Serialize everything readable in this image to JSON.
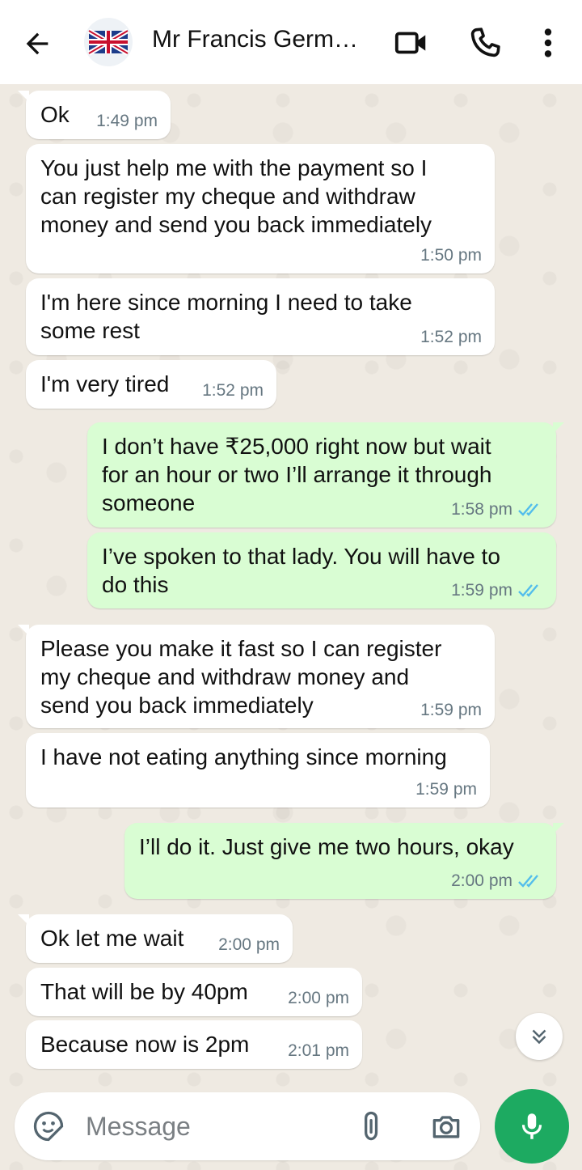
{
  "header": {
    "contact_name": "Mr Francis Germ…",
    "back_icon": "arrow-left-icon",
    "video_icon": "video-call-icon",
    "call_icon": "phone-icon",
    "menu_icon": "more-vert-icon"
  },
  "messages": [
    {
      "dir": "in",
      "text": "Ok",
      "time": "1:49 pm"
    },
    {
      "dir": "in",
      "text": "You just help me with the payment so I\ncan register my cheque and withdraw\nmoney and send you back immediately",
      "time": "1:50 pm"
    },
    {
      "dir": "in",
      "text": "I'm here since morning I need to take\nsome rest",
      "time": "1:52 pm"
    },
    {
      "dir": "in",
      "text": "I'm very tired",
      "time": "1:52 pm"
    },
    {
      "dir": "out",
      "text": "I don’t have ₹25,000 right now but wait\nfor an hour or two I’ll arrange it through\nsomeone",
      "time": "1:58 pm"
    },
    {
      "dir": "out",
      "text": "I’ve spoken to that lady. You will have to\ndo this",
      "time": "1:59 pm"
    },
    {
      "dir": "in",
      "text": "Please you make it fast so I can register\nmy cheque and withdraw money and\nsend you back immediately",
      "time": "1:59 pm"
    },
    {
      "dir": "in",
      "text": "I have not eating anything since morning",
      "time": "1:59 pm"
    },
    {
      "dir": "out",
      "text": "I’ll do it. Just give me two hours, okay",
      "time": "2:00 pm"
    },
    {
      "dir": "in",
      "text": "Ok let me wait",
      "time": "2:00 pm"
    },
    {
      "dir": "in",
      "text": "That will be by 40pm",
      "time": "2:00 pm"
    },
    {
      "dir": "in",
      "text": "Because now is 2pm",
      "time": "2:01 pm"
    }
  ],
  "composer": {
    "placeholder": "Message",
    "emoji_icon": "sticker-icon",
    "attach_icon": "paperclip-icon",
    "camera_icon": "camera-icon",
    "mic_icon": "microphone-icon"
  },
  "colors": {
    "incoming": "#ffffff",
    "outgoing": "#d9fdd3",
    "accent": "#1daa61",
    "read_ticks": "#53bdeb"
  }
}
